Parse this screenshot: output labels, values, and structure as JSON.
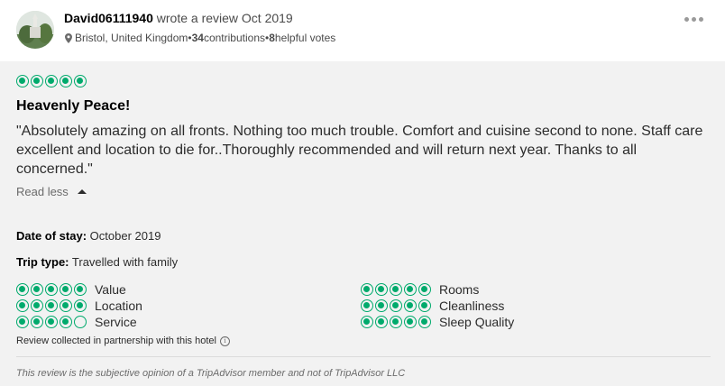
{
  "reviewer": {
    "name": "David06111940",
    "action_text": " wrote a review Oct 2019",
    "location": "Bristol, United Kingdom",
    "separator": " • ",
    "contributions": "34",
    "contributions_label": " contributions",
    "helpful": "8",
    "helpful_label": " helpful votes"
  },
  "review": {
    "bubble_rating": 5,
    "title": "Heavenly Peace!",
    "text": "\"Absolutely amazing on all fronts. Nothing too much trouble. Comfort and cuisine second to none. Staff care excellent and location to die for..Thoroughly recommended and will return next year. Thanks to all concerned.\"",
    "read_less": "Read less",
    "date_of_stay_label": "Date of stay:",
    "date_of_stay": "October 2019",
    "trip_type_label": "Trip type:",
    "trip_type": "Travelled with family"
  },
  "ratings_left": [
    {
      "label": "Value",
      "score": 5
    },
    {
      "label": "Location",
      "score": 5
    },
    {
      "label": "Service",
      "score": 4
    }
  ],
  "ratings_right": [
    {
      "label": "Rooms",
      "score": 5
    },
    {
      "label": "Cleanliness",
      "score": 5
    },
    {
      "label": "Sleep Quality",
      "score": 5
    }
  ],
  "partnership": "Review collected in partnership with this hotel",
  "info_glyph": "i",
  "disclaimer": "This review is the subjective opinion of a TripAdvisor member and not of TripAdvisor LLC",
  "colors": {
    "bubble": "#00aa6c",
    "body_bg": "#f2f2f2"
  },
  "icons": {
    "location": "map-pin-icon",
    "more": "more-dots-icon",
    "info": "info-icon",
    "caret": "caret-up-icon"
  }
}
